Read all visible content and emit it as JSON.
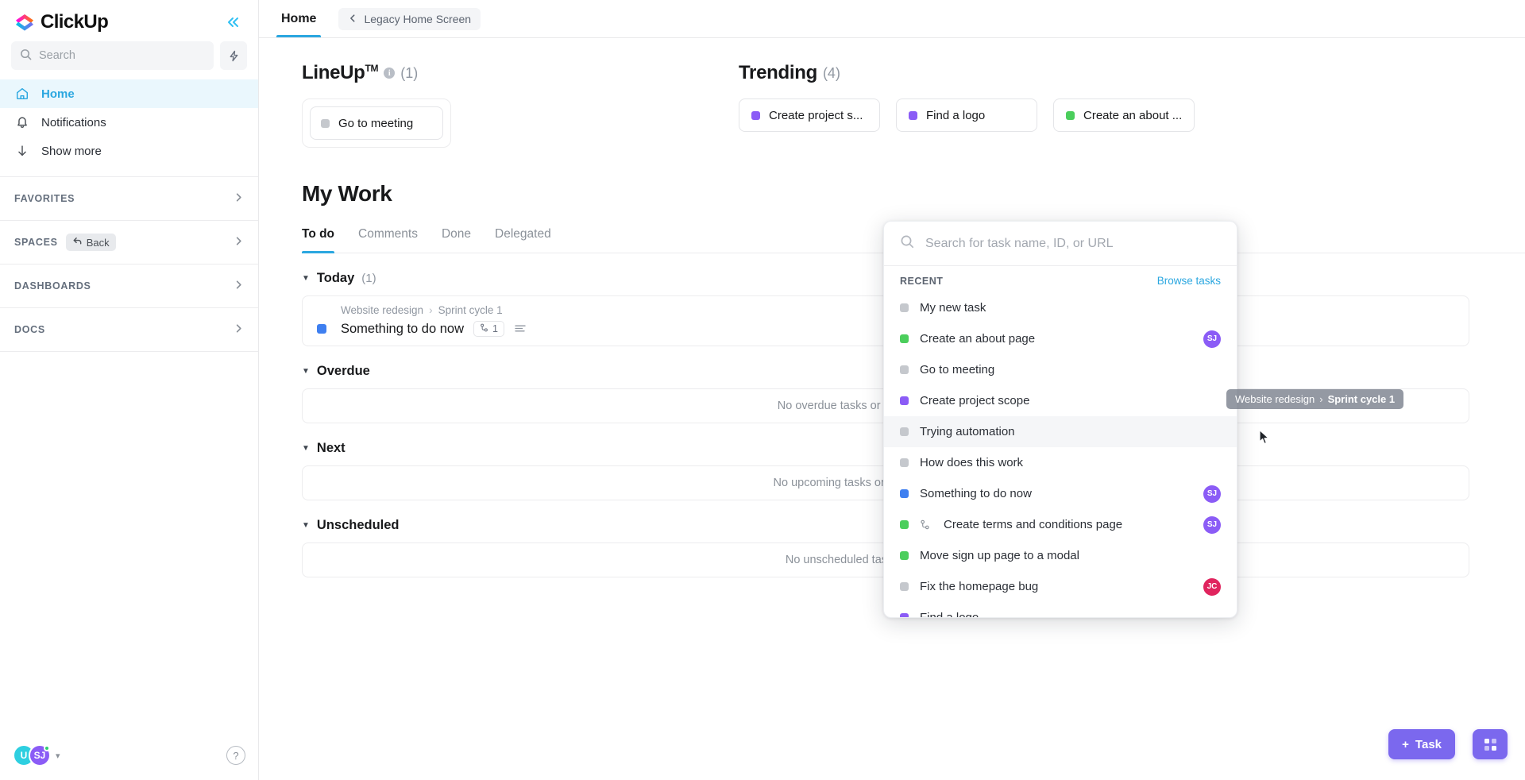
{
  "sidebar": {
    "brand": "ClickUp",
    "search": {
      "placeholder": "Search",
      "value": ""
    },
    "bolt_tooltip": "",
    "nav": [
      {
        "label": "Home",
        "icon": "home-icon",
        "active": true
      },
      {
        "label": "Notifications",
        "icon": "bell-icon",
        "active": false
      },
      {
        "label": "Show more",
        "icon": "arrow-down-icon",
        "active": false
      }
    ],
    "sections": [
      {
        "label": "FAVORITES",
        "chip": null
      },
      {
        "label": "SPACES",
        "chip": "Back"
      },
      {
        "label": "DASHBOARDS",
        "chip": null
      },
      {
        "label": "DOCS",
        "chip": null
      }
    ],
    "footer": {
      "avatar_1": "U",
      "avatar_2": "SJ",
      "help": "?"
    }
  },
  "topbar": {
    "tab": "Home",
    "legacy_button": "Legacy Home Screen"
  },
  "lineup": {
    "title": "LineUp",
    "trademark": "TM",
    "count": "(1)",
    "items": [
      {
        "label": "Go to meeting",
        "color": "#c5c8cd"
      }
    ]
  },
  "trending": {
    "title": "Trending",
    "count": "(4)",
    "cards": [
      {
        "label": "Create project s...",
        "color": "#8b5cf6"
      },
      {
        "label": "Find a logo",
        "color": "#8b5cf6"
      },
      {
        "label": "Create an about ...",
        "color": "#4bce5c"
      }
    ]
  },
  "my_work": {
    "title": "My Work",
    "tabs": [
      {
        "label": "To do",
        "active": true
      },
      {
        "label": "Comments",
        "active": false
      },
      {
        "label": "Done",
        "active": false
      },
      {
        "label": "Delegated",
        "active": false
      }
    ],
    "groups": [
      {
        "name": "Today",
        "count": "(1)",
        "empty_text": null,
        "task": {
          "breadcrumb_parent": "Website redesign",
          "breadcrumb_sep": "›",
          "breadcrumb_child": "Sprint cycle 1",
          "name": "Something to do now",
          "subtask_count": "1",
          "color": "#3e7ff0"
        }
      },
      {
        "name": "Overdue",
        "count": "",
        "empty_text": "No overdue tasks or reminders scheduled."
      },
      {
        "name": "Next",
        "count": "",
        "empty_text": "No upcoming tasks or reminders scheduled."
      },
      {
        "name": "Unscheduled",
        "count": "",
        "empty_text": "No unscheduled tasks assigned to you."
      }
    ]
  },
  "search_popup": {
    "placeholder": "Search for task name, ID, or URL",
    "value": "",
    "recent_label": "RECENT",
    "browse_label": "Browse tasks",
    "items": [
      {
        "name": "My new task",
        "color": "#c5c8cd",
        "avatar": null,
        "avatar_color": null,
        "has_subtask_icon": false,
        "hover": false
      },
      {
        "name": "Create an about page",
        "color": "#4bce5c",
        "avatar": "SJ",
        "avatar_color": "#8b5cf6",
        "has_subtask_icon": false,
        "hover": false
      },
      {
        "name": "Go to meeting",
        "color": "#c5c8cd",
        "avatar": null,
        "avatar_color": null,
        "has_subtask_icon": false,
        "hover": false
      },
      {
        "name": "Create project scope",
        "color": "#8b5cf6",
        "avatar": null,
        "avatar_color": null,
        "has_subtask_icon": false,
        "hover": false
      },
      {
        "name": "Trying automation",
        "color": "#c5c8cd",
        "avatar": null,
        "avatar_color": null,
        "has_subtask_icon": false,
        "hover": true
      },
      {
        "name": "How does this work",
        "color": "#c5c8cd",
        "avatar": null,
        "avatar_color": null,
        "has_subtask_icon": false,
        "hover": false
      },
      {
        "name": "Something to do now",
        "color": "#3e7ff0",
        "avatar": "SJ",
        "avatar_color": "#8b5cf6",
        "has_subtask_icon": false,
        "hover": false
      },
      {
        "name": "Create terms and conditions page",
        "color": "#4bce5c",
        "avatar": "SJ",
        "avatar_color": "#8b5cf6",
        "has_subtask_icon": true,
        "hover": false
      },
      {
        "name": "Move sign up page to a modal",
        "color": "#4bce5c",
        "avatar": null,
        "avatar_color": null,
        "has_subtask_icon": false,
        "hover": false
      },
      {
        "name": "Fix the homepage bug",
        "color": "#c5c8cd",
        "avatar": "JC",
        "avatar_color": "#e0245e",
        "has_subtask_icon": false,
        "hover": false
      },
      {
        "name": "Find a logo",
        "color": "#8b5cf6",
        "avatar": null,
        "avatar_color": null,
        "has_subtask_icon": false,
        "hover": false
      }
    ]
  },
  "tooltip": {
    "parent": "Website redesign",
    "sep": "›",
    "child": "Sprint cycle 1"
  },
  "fab": {
    "task_label": "Task",
    "plus": "+"
  },
  "colors": {
    "accent_blue": "#2ba7e0",
    "purple": "#7b68ee",
    "green": "#4bce5c",
    "grey": "#c5c8cd"
  }
}
